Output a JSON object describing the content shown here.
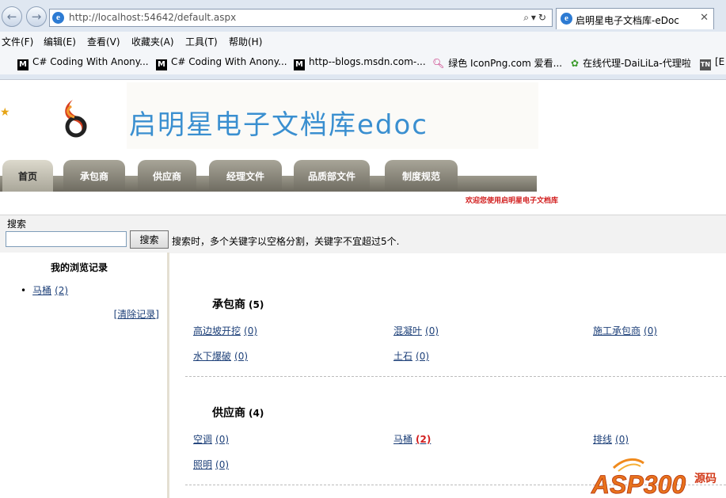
{
  "browser": {
    "url": "http://localhost:54642/default.aspx",
    "tab_title": "启明星电子文档库-eDoc",
    "menus": [
      "文件(F)",
      "编辑(E)",
      "查看(V)",
      "收藏夹(A)",
      "工具(T)",
      "帮助(H)"
    ],
    "favorites": [
      {
        "icon": "M",
        "label": "C# Coding With Anony..."
      },
      {
        "icon": "M",
        "label": "C# Coding With Anony..."
      },
      {
        "icon": "M",
        "label": "http--blogs.msdn.com-..."
      },
      {
        "icon": "search-icon",
        "label": "绿色 IconPng.com 爱看..."
      },
      {
        "icon": "leaf-icon",
        "label": "在线代理-DaiLiLa-代理啦"
      },
      {
        "icon": "TN",
        "label": "[E"
      }
    ]
  },
  "site": {
    "title": "启明星电子文档库edoc",
    "welcome": "欢迎您使用启明星电子文档库",
    "nav": [
      "首页",
      "承包商",
      "供应商",
      "经理文件",
      "品质部文件",
      "制度规范"
    ],
    "active_nav": "首页"
  },
  "search": {
    "label": "搜索",
    "value": "",
    "button": "搜索",
    "hint": "搜索时，多个关键字以空格分割，关键字不宜超过5个."
  },
  "history": {
    "title": "我的浏览记录",
    "items": [
      {
        "name": "马桶",
        "count": "(2)"
      }
    ],
    "clear": "[清除记录]"
  },
  "categories": [
    {
      "name": "承包商",
      "count": "(5)",
      "items": [
        {
          "name": "高边坡开挖",
          "count": "(0)"
        },
        {
          "name": "混凝叶",
          "count": "(0)"
        },
        {
          "name": "施工承包商",
          "count": "(0)"
        },
        {
          "name": "水下爆破",
          "count": "(0)"
        },
        {
          "name": "土石",
          "count": "(0)"
        }
      ]
    },
    {
      "name": "供应商",
      "count": "(4)",
      "items": [
        {
          "name": "空调",
          "count": "(0)"
        },
        {
          "name": "马桶",
          "count": "(2)"
        },
        {
          "name": "排线",
          "count": "(0)"
        },
        {
          "name": "照明",
          "count": "(0)"
        }
      ]
    }
  ],
  "watermark": {
    "text": "ASP300",
    "sub": "源码"
  }
}
